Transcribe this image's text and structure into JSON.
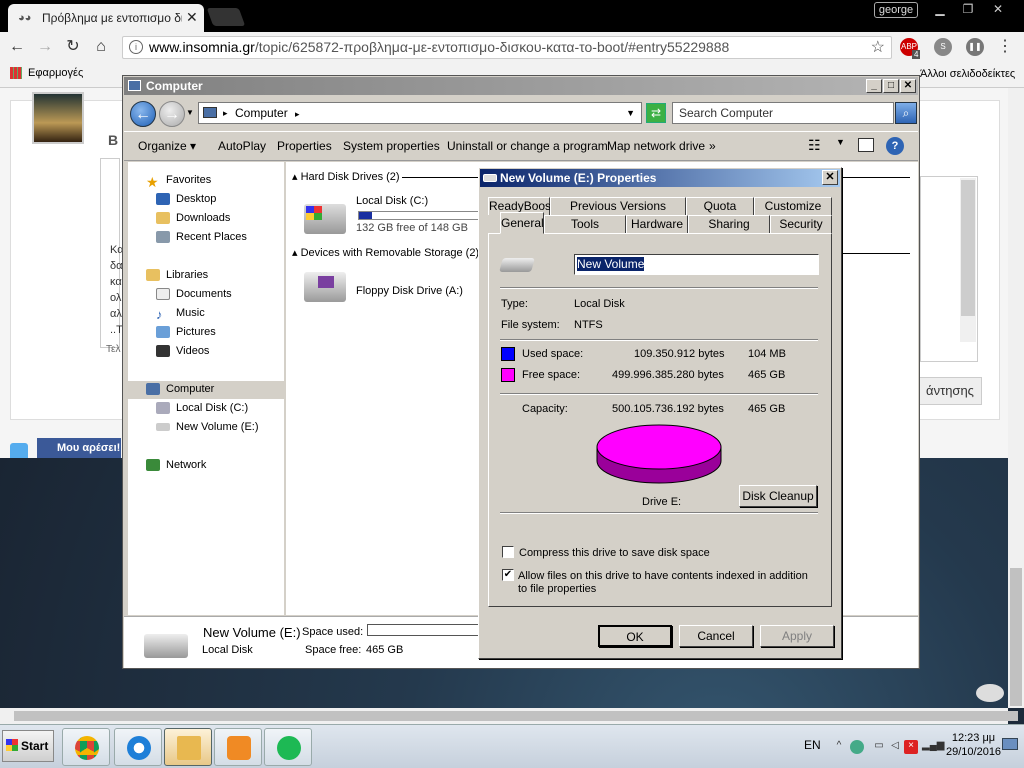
{
  "browser": {
    "tab_title": "Πρόβλημα με εντοπισμο δι",
    "tab_close": "✕",
    "user": "george",
    "url_domain": "www.insomnia.gr",
    "url_path": "/topic/625872-προβλημα-με-εντοπισμο-δισκου-κατα-το-boot/#entry55229888",
    "apps_label": "Εφαρμογές",
    "other_bookmarks": "Άλλοι σελιδοδείκτες",
    "ext_abp": "ABP",
    "ext_abp_badge": "4"
  },
  "web": {
    "reply_button": "άντησης",
    "fb_button": "Μου αρέσει!",
    "side_text": [
      "Κα",
      "δα",
      "κα",
      "ολ",
      "αλ",
      "..T"
    ],
    "footer_label": "Τελ"
  },
  "explorer": {
    "title": "Computer",
    "address": "Computer",
    "search_placeholder": "Search Computer",
    "commands": [
      "Organize",
      "AutoPlay",
      "Properties",
      "System properties",
      "Uninstall or change a program",
      "Map network drive",
      "»"
    ],
    "nav": [
      {
        "label": "Favorites",
        "icon": "star-icon"
      },
      {
        "label": "Desktop",
        "icon": "desktop-icon"
      },
      {
        "label": "Downloads",
        "icon": "downloads-icon"
      },
      {
        "label": "Recent Places",
        "icon": "recent-places-icon"
      },
      {
        "label": "Libraries",
        "icon": "libraries-icon"
      },
      {
        "label": "Documents",
        "icon": "documents-icon"
      },
      {
        "label": "Music",
        "icon": "music-icon"
      },
      {
        "label": "Pictures",
        "icon": "pictures-icon"
      },
      {
        "label": "Videos",
        "icon": "videos-icon"
      },
      {
        "label": "Computer",
        "icon": "computer-icon"
      },
      {
        "label": "Local Disk (C:)",
        "icon": "drive-icon"
      },
      {
        "label": "New Volume (E:)",
        "icon": "drive-icon"
      },
      {
        "label": "Network",
        "icon": "network-icon"
      }
    ],
    "group_hdd": "Hard Disk Drives (2)",
    "group_removable": "Devices with Removable Storage (2)",
    "drive_c_name": "Local Disk (C:)",
    "drive_c_free": "132 GB free of 148 GB",
    "drive_c_used_fraction": 0.11,
    "floppy_name": "Floppy Disk Drive (A:)",
    "details": {
      "name": "New Volume (E:)",
      "type": "Local Disk",
      "space_used_label": "Space used:",
      "space_free_label": "Space free:",
      "space_free_value": "465 GB"
    }
  },
  "dialog": {
    "title": "New Volume (E:) Properties",
    "close": "✕",
    "tabs_row1": [
      "ReadyBoost",
      "Previous Versions",
      "Quota",
      "Customize"
    ],
    "tabs_row2": [
      "General",
      "Tools",
      "Hardware",
      "Sharing",
      "Security"
    ],
    "volume_name": "New Volume",
    "type_label": "Type:",
    "type_value": "Local Disk",
    "fs_label": "File system:",
    "fs_value": "NTFS",
    "used_label": "Used space:",
    "used_bytes": "109.350.912 bytes",
    "used_size": "104 MB",
    "free_label": "Free space:",
    "free_bytes": "499.996.385.280 bytes",
    "free_size": "465 GB",
    "capacity_label": "Capacity:",
    "capacity_bytes": "500.105.736.192 bytes",
    "capacity_size": "465 GB",
    "drive_label": "Drive E:",
    "disk_cleanup": "Disk Cleanup",
    "compress_label": "Compress this drive to save disk space",
    "compress_checked": false,
    "index_label": "Allow files on this drive to have contents indexed in addition to file properties",
    "index_checked": true,
    "ok": "OK",
    "cancel": "Cancel",
    "apply": "Apply",
    "colors": {
      "used": "#0000ff",
      "free": "#ff00ff"
    }
  },
  "taskbar": {
    "start": "Start",
    "lang": "EN",
    "time": "12:23 μμ",
    "date": "29/10/2016"
  }
}
